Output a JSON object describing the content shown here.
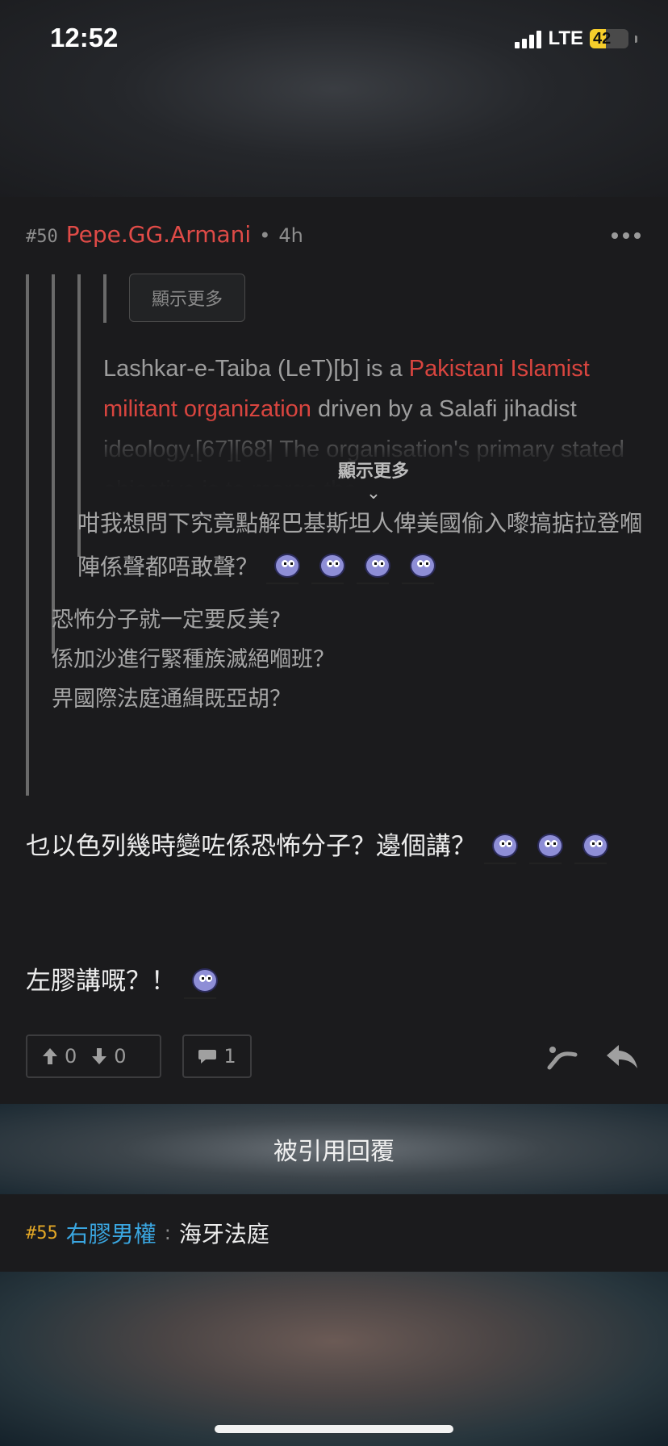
{
  "status_bar": {
    "time": "12:52",
    "network": "LTE",
    "battery": "42"
  },
  "post": {
    "number": "#50",
    "author": "Pepe.GG.Armani",
    "separator": "•",
    "age": "4h",
    "quote_level3": {
      "show_more_button": "顯示更多",
      "text_before": "Lashkar-e-Taiba (LeT)[b] is a ",
      "text_highlight": "Pakistani Islamist militant organization",
      "text_after": " driven by a Salafi jihadist ideology.[67][68] The organisation's primary stated objective is to merge the",
      "expand_label": "顯示更多",
      "expand_chevron": "⌄"
    },
    "quote_level2": {
      "text": "咁我想問下究竟點解巴基斯坦人俾美國偷入嚟搞掂拉登嗰陣係聲都唔敢聲？"
    },
    "quote_level1": {
      "lines": [
        "恐怖分子就一定要反美?",
        "係加沙進行緊種族滅絕嗰班？",
        "畀國際法庭通緝既亞胡？"
      ]
    },
    "body_line1": "乜以色列幾時變咗係恐怖分子？邊個講？",
    "body_line2": "左膠講嘅？！",
    "upvotes": "0",
    "downvotes": "0",
    "comments": "1"
  },
  "quoted_replies": {
    "header": "被引用回覆",
    "items": [
      {
        "number": "#55",
        "author": "右膠男權",
        "separator": ":",
        "text": "海牙法庭"
      }
    ]
  }
}
